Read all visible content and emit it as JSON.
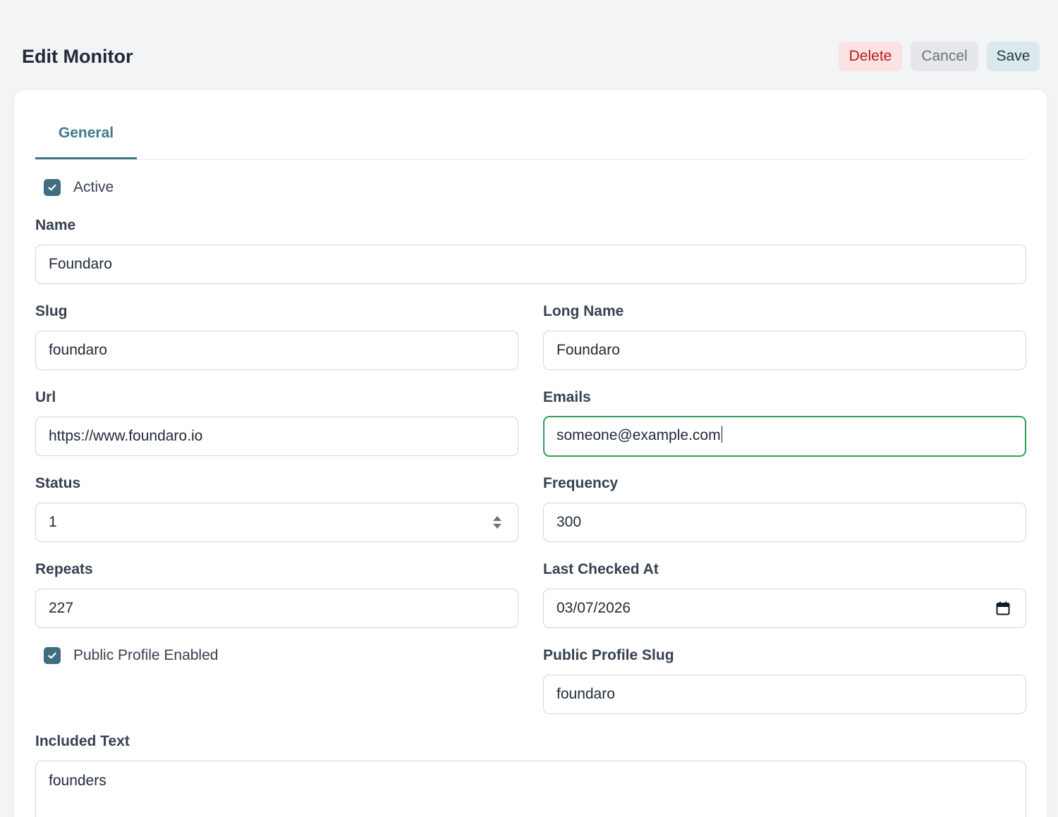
{
  "header": {
    "title": "Edit Monitor",
    "buttons": {
      "delete": "Delete",
      "cancel": "Cancel",
      "save": "Save"
    }
  },
  "tabs": [
    {
      "label": "General",
      "active": true
    }
  ],
  "form": {
    "active": {
      "label": "Active",
      "checked": true
    },
    "name": {
      "label": "Name",
      "value": "Foundaro"
    },
    "slug": {
      "label": "Slug",
      "value": "foundaro"
    },
    "long_name": {
      "label": "Long Name",
      "value": "Foundaro"
    },
    "url": {
      "label": "Url",
      "value": "https://www.foundaro.io"
    },
    "emails": {
      "label": "Emails",
      "value": "someone@example.com",
      "focused": true
    },
    "status": {
      "label": "Status",
      "value": "1"
    },
    "frequency": {
      "label": "Frequency",
      "value": "300"
    },
    "repeats": {
      "label": "Repeats",
      "value": "227"
    },
    "last_checked_at": {
      "label": "Last Checked At",
      "value": "03/07/2026"
    },
    "public_profile_enabled": {
      "label": "Public Profile Enabled",
      "checked": true
    },
    "public_profile_slug": {
      "label": "Public Profile Slug",
      "value": "foundaro"
    },
    "included_text": {
      "label": "Included Text",
      "value": "founders"
    }
  },
  "colors": {
    "accent": "#3f7a8c",
    "focus_border": "#2f9e5c",
    "delete_bg": "#fde2e4",
    "delete_text": "#b91c1c",
    "save_bg": "#dbe9ec",
    "checkbox": "#3f6e80"
  },
  "icons": {
    "checkbox": "check-icon",
    "number_spinner": "spinner-arrows-icon",
    "date_picker": "calendar-icon"
  }
}
